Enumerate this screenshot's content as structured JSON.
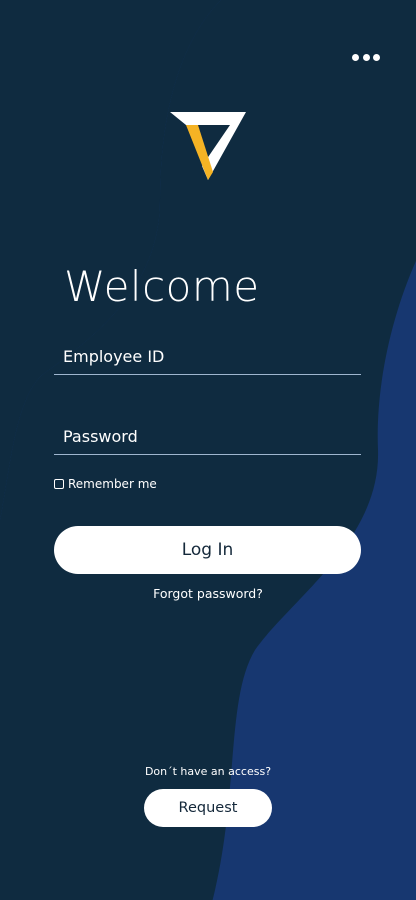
{
  "colors": {
    "background_dark": "#0f2b40",
    "background_blue": "#173770",
    "logo_white": "#ffffff",
    "logo_accent": "#f5b324",
    "button_bg": "#ffffff",
    "button_text": "#14283a",
    "field_underline": "#9fb6cf"
  },
  "header": {
    "menu_icon": "more-horizontal-icon"
  },
  "brand": {
    "logo_icon": "v-logo-icon"
  },
  "welcome": {
    "title": "Welcome"
  },
  "form": {
    "employee_id": {
      "placeholder": "Employee ID",
      "value": ""
    },
    "password": {
      "placeholder": "Password",
      "value": ""
    },
    "remember_me": {
      "label": "Remember me",
      "checked": false
    },
    "login_label": "Log In",
    "forgot_label": "Forgot password?"
  },
  "footer": {
    "prompt": "Don´t have an access?",
    "request_label": "Request"
  }
}
